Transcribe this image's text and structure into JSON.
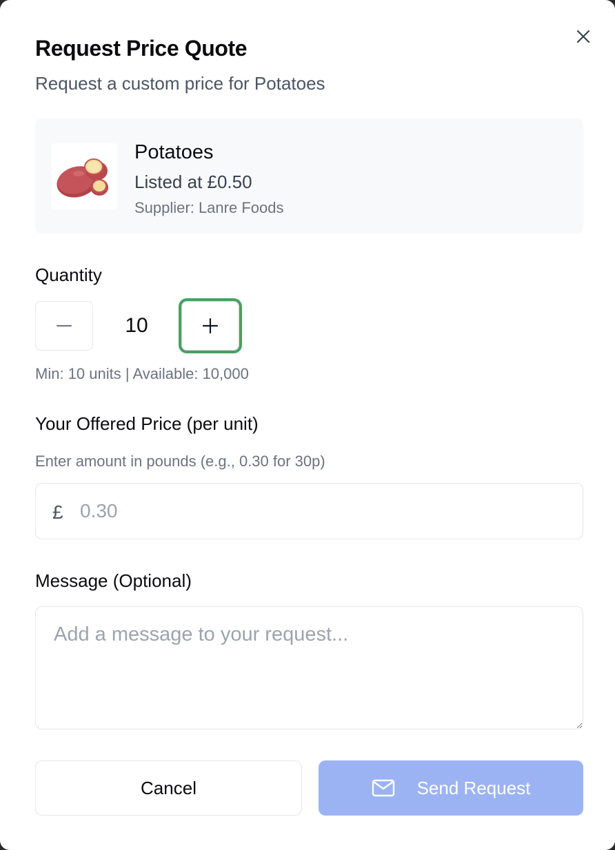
{
  "dialog": {
    "title": "Request Price Quote",
    "subtitle": "Request a custom price for Potatoes",
    "close_icon": "close-icon"
  },
  "product": {
    "name": "Potatoes",
    "listed_price": "Listed at £0.50",
    "supplier": "Supplier: Lanre Foods",
    "image_icon": "potato-image"
  },
  "quantity": {
    "label": "Quantity",
    "value": "10",
    "decrement_icon": "minus-icon",
    "increment_icon": "plus-icon",
    "hint": "Min: 10 units | Available: 10,000"
  },
  "offered_price": {
    "label": "Your Offered Price (per unit)",
    "hint": "Enter amount in pounds (e.g., 0.30 for 30p)",
    "currency_symbol": "£",
    "value": "",
    "placeholder": "0.30"
  },
  "message": {
    "label": "Message (Optional)",
    "value": "",
    "placeholder": "Add a message to your request..."
  },
  "actions": {
    "cancel_label": "Cancel",
    "send_label": "Send Request",
    "send_icon": "mail-icon"
  },
  "colors": {
    "focus_ring": "#4a9f63",
    "send_button_disabled": "#9cb3f3",
    "card_background": "#f8f9fb"
  }
}
